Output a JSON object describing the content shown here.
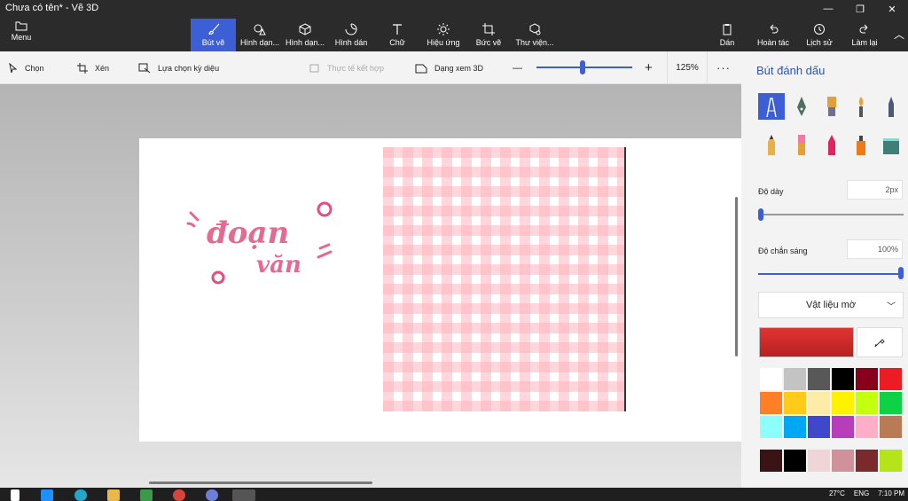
{
  "window": {
    "title": "Chưa có tên* - Vẽ 3D"
  },
  "ribbon": {
    "menu_label": "Menu",
    "tools": [
      {
        "label": "Bút vẽ",
        "icon": "brush-icon",
        "active": true
      },
      {
        "label": "Hình dạn...",
        "icon": "2d-shapes-icon",
        "active": false
      },
      {
        "label": "Hình dạn...",
        "icon": "3d-shapes-icon",
        "active": false
      },
      {
        "label": "Hình dán",
        "icon": "stickers-icon",
        "active": false
      },
      {
        "label": "Chữ",
        "icon": "text-icon",
        "active": false
      },
      {
        "label": "Hiệu ứng",
        "icon": "effects-icon",
        "active": false
      },
      {
        "label": "Bức vẽ",
        "icon": "canvas-icon",
        "active": false
      },
      {
        "label": "Thư viện...",
        "icon": "library-icon",
        "active": false
      }
    ],
    "right_tools": [
      {
        "label": "Dán",
        "icon": "paste-icon"
      },
      {
        "label": "Hoàn tác",
        "icon": "undo-icon"
      },
      {
        "label": "Lịch sử",
        "icon": "history-icon"
      },
      {
        "label": "Làm lại",
        "icon": "redo-icon"
      }
    ]
  },
  "subbar": {
    "select_label": "Chọn",
    "crop_label": "Xén",
    "magic_select_label": "Lựa chọn kỳ diệu",
    "mixed_reality_label": "Thực tế kết hợp",
    "view3d_label": "Dạng xem 3D",
    "zoom_value": "125%",
    "zoom_fraction": 0.48,
    "minus": "—",
    "plus": "+",
    "more": "···"
  },
  "canvas": {
    "sticker_text_line1": "đoạn",
    "sticker_text_line2": "văn"
  },
  "panel": {
    "title": "Bút đánh dấu",
    "thickness_label": "Độ dày",
    "thickness_value": "2px",
    "thickness_fraction": 0.0,
    "opacity_label": "Độ chắn sáng",
    "opacity_value": "100%",
    "opacity_fraction": 1.0,
    "material_label": "Vật liệu mờ",
    "current_color": "#e03434",
    "brushes": [
      "marker-icon",
      "calligraphy-pen-icon",
      "oil-brush-icon",
      "watercolor-icon",
      "pixel-pen-icon",
      "pencil-icon",
      "eraser-icon",
      "crayon-icon",
      "spray-can-icon",
      "fill-icon"
    ],
    "palette": [
      "#ffffff",
      "#c3c3c3",
      "#585858",
      "#000000",
      "#88001b",
      "#ec1c24",
      "#ff7f27",
      "#ffca18",
      "#fdeca6",
      "#fff200",
      "#c4ff0e",
      "#0ed145",
      "#8cfffb",
      "#00a8f3",
      "#3f48cc",
      "#b83dba",
      "#ffaec8",
      "#b97a56"
    ],
    "custom_colors": [
      "#3a1414",
      "#000000",
      "#f0d5d8",
      "#d0919a",
      "#7a2a2a",
      "#b6e41a"
    ]
  },
  "taskbar": {
    "weather": "27°C",
    "lang": "ENG",
    "time": "7:10 PM"
  }
}
